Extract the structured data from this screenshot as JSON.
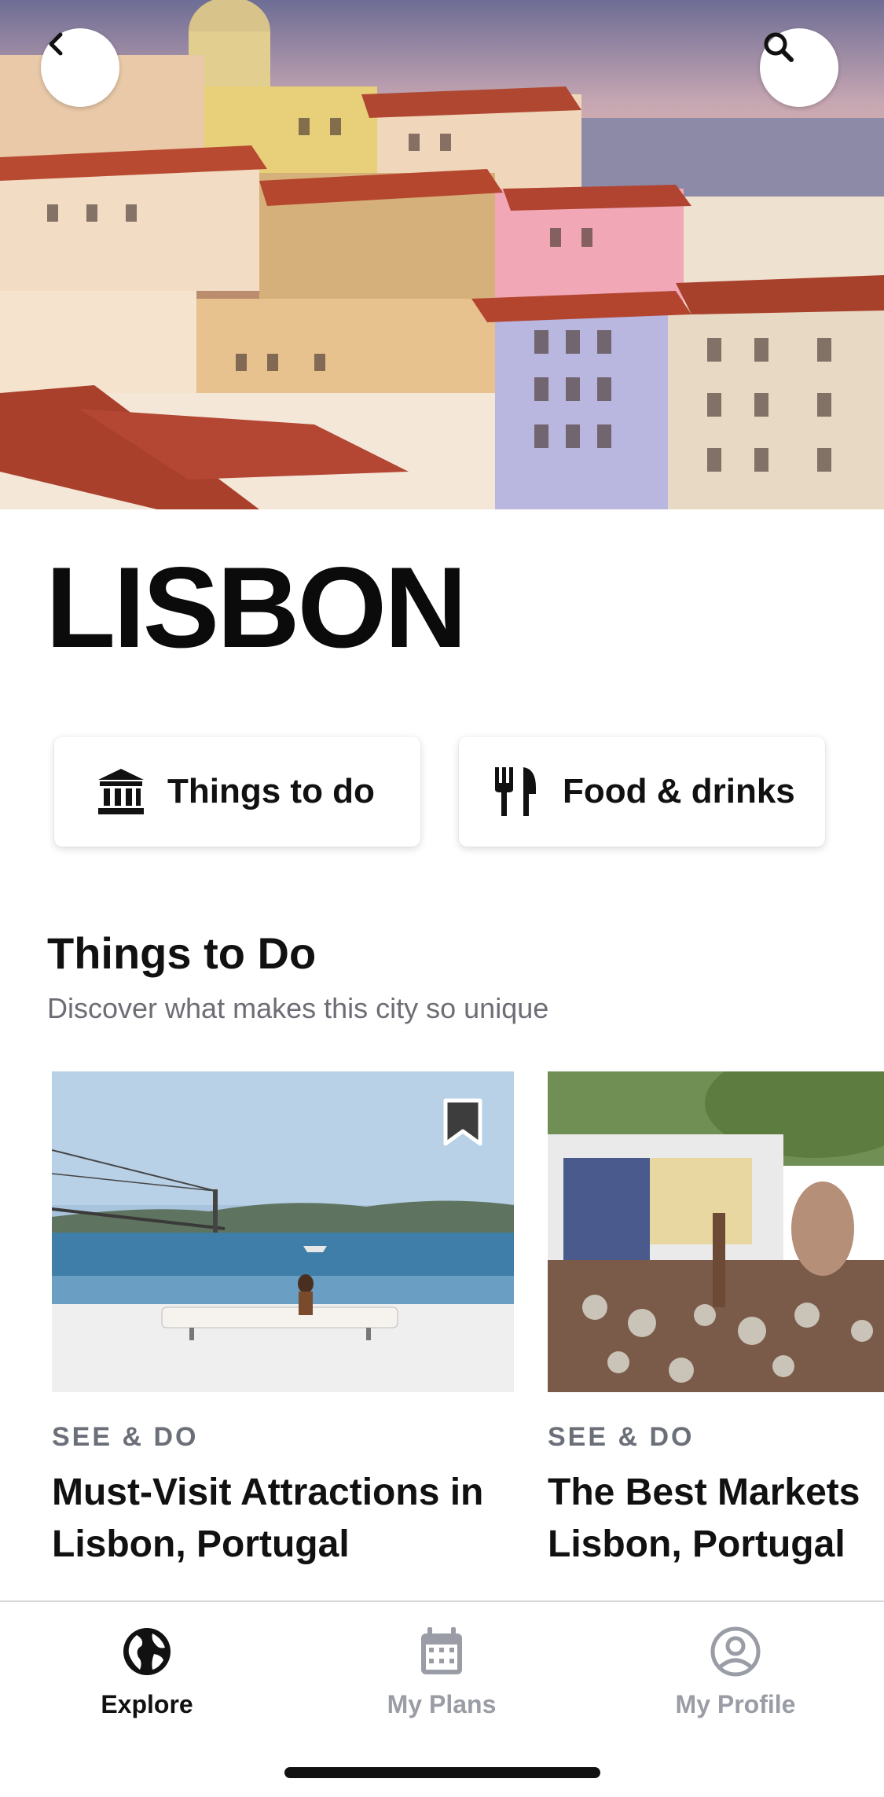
{
  "city": {
    "title": "LISBON"
  },
  "header": {
    "back_icon": "chevron-left-icon",
    "search_icon": "search-icon"
  },
  "categories": [
    {
      "label": "Things to do",
      "icon": "landmark-icon"
    },
    {
      "label": "Food & drinks",
      "icon": "fork-knife-icon"
    }
  ],
  "section": {
    "title": "Things to Do",
    "subtitle": "Discover what makes this city so unique"
  },
  "cards": [
    {
      "kicker": "SEE & DO",
      "title_line1": "Must-Visit Attractions in",
      "title_line2": "Lisbon, Portugal",
      "bookmarked": false
    },
    {
      "kicker": "SEE & DO",
      "title_line1": "The Best Markets",
      "title_line2": "Lisbon, Portugal"
    }
  ],
  "tabs": [
    {
      "label": "Explore",
      "icon": "globe-icon",
      "active": true
    },
    {
      "label": "My Plans",
      "icon": "calendar-icon",
      "active": false
    },
    {
      "label": "My Profile",
      "icon": "user-icon",
      "active": false
    }
  ],
  "colors": {
    "active_tab": "#111111",
    "inactive_tab": "#9a9ca6",
    "kicker": "#6b6f78"
  }
}
